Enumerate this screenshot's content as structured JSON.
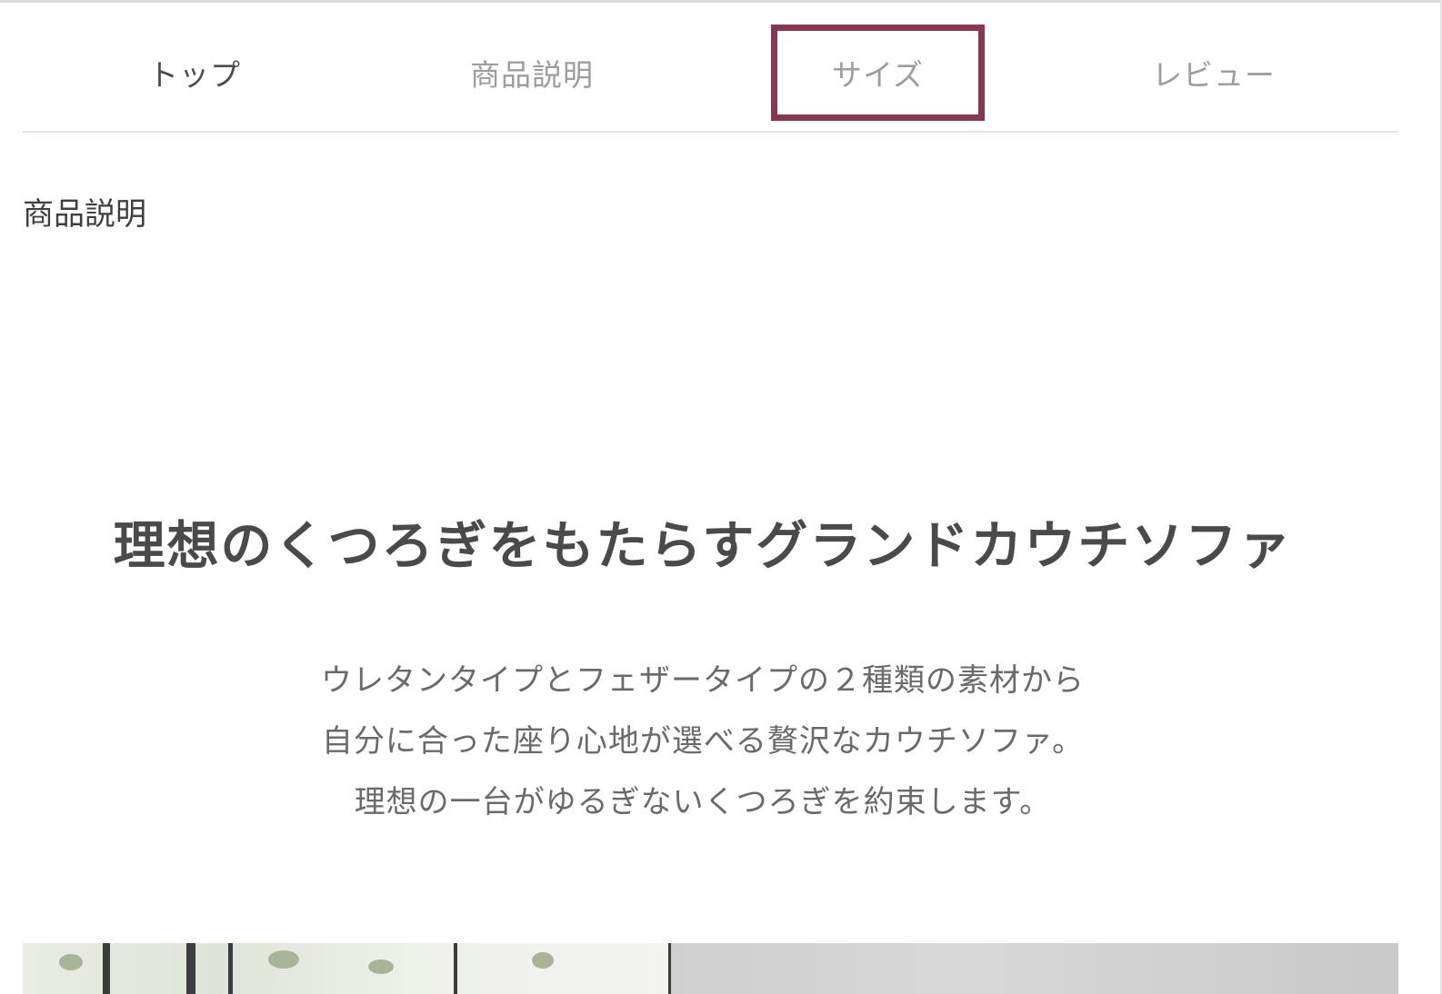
{
  "tabs": [
    {
      "label": "トップ"
    },
    {
      "label": "商品説明"
    },
    {
      "label": "サイズ"
    },
    {
      "label": "レビュー"
    }
  ],
  "section": {
    "title": "商品説明"
  },
  "product": {
    "headline": "理想のくつろぎをもたらすグランドカウチソファ",
    "description": [
      "ウレタンタイプとフェザータイプの２種類の素材から",
      "自分に合った座り心地が選べる贅沢なカウチソファ。",
      "理想の一台がゆるぎないくつろぎを約束します。"
    ]
  },
  "colors": {
    "highlight_border": "#8a3652",
    "tab_active_text": "#4d4d4d",
    "tab_inactive_text": "#9d9d9d"
  }
}
